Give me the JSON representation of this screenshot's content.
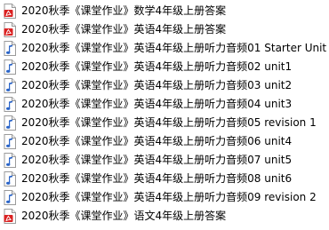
{
  "colors": {
    "pdf_accent": "#d92121",
    "audio_note": "#2a64c8",
    "text": "#000000",
    "background": "#ffffff"
  },
  "files": [
    {
      "name": "2020秋季《课堂作业》数学4年级上册答案",
      "icon": "pdf-icon"
    },
    {
      "name": "2020秋季《课堂作业》英语4年级上册答案",
      "icon": "pdf-icon"
    },
    {
      "name": "2020秋季《课堂作业》英语4年级上册听力音频01 Starter Unit",
      "icon": "audio-file-icon"
    },
    {
      "name": "2020秋季《课堂作业》英语4年级上册听力音频02 unit1",
      "icon": "audio-file-icon"
    },
    {
      "name": "2020秋季《课堂作业》英语4年级上册听力音频03 unit2",
      "icon": "audio-file-icon"
    },
    {
      "name": "2020秋季《课堂作业》英语4年级上册听力音频04 unit3",
      "icon": "audio-file-icon"
    },
    {
      "name": "2020秋季《课堂作业》英语4年级上册听力音频05 revision 1",
      "icon": "audio-file-icon"
    },
    {
      "name": "2020秋季《课堂作业》英语4年级上册听力音频06 unit4",
      "icon": "audio-file-icon"
    },
    {
      "name": "2020秋季《课堂作业》英语4年级上册听力音频07 unit5",
      "icon": "audio-file-icon"
    },
    {
      "name": "2020秋季《课堂作业》英语4年级上册听力音频08 unit6",
      "icon": "audio-file-icon"
    },
    {
      "name": "2020秋季《课堂作业》英语4年级上册听力音频09 revision 2",
      "icon": "audio-file-icon"
    },
    {
      "name": "2020秋季《课堂作业》语文4年级上册答案",
      "icon": "pdf-icon"
    }
  ]
}
